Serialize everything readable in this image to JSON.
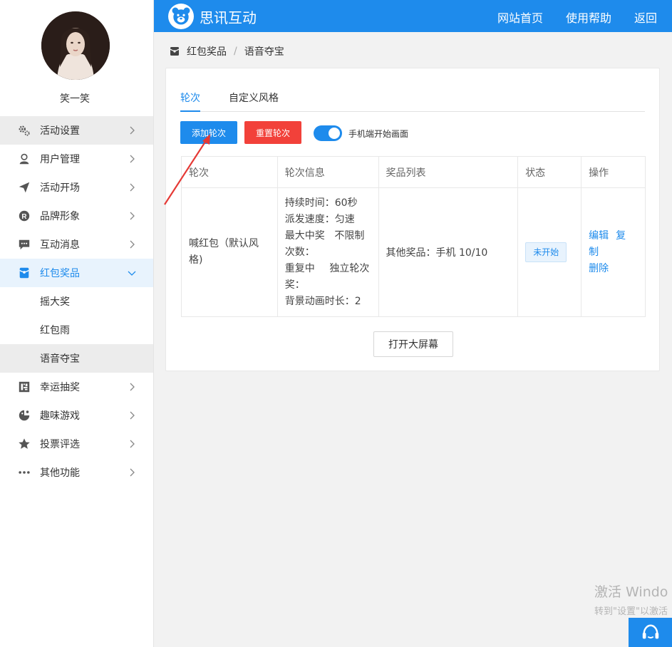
{
  "user": {
    "name": "笑一笑"
  },
  "sidebar": {
    "items": [
      {
        "label": "活动设置",
        "icon": "gears-icon"
      },
      {
        "label": "用户管理",
        "icon": "user-icon"
      },
      {
        "label": "活动开场",
        "icon": "paper-plane-icon"
      },
      {
        "label": "品牌形象",
        "icon": "registered-icon"
      },
      {
        "label": "互动消息",
        "icon": "chat-icon"
      },
      {
        "label": "红包奖品",
        "icon": "red-packet-icon"
      },
      {
        "label": "幸运抽奖",
        "icon": "lottery-icon"
      },
      {
        "label": "趣味游戏",
        "icon": "game-icon"
      },
      {
        "label": "投票评选",
        "icon": "star-icon"
      },
      {
        "label": "其他功能",
        "icon": "more-icon"
      }
    ],
    "sub_items": [
      "摇大奖",
      "红包雨",
      "语音夺宝"
    ]
  },
  "header": {
    "brand": "思讯互动",
    "nav": [
      "网站首页",
      "使用帮助",
      "返回"
    ]
  },
  "breadcrumb": {
    "parent": "红包奖品",
    "separator": "/",
    "current": "语音夺宝"
  },
  "tabs": [
    "轮次",
    "自定义风格"
  ],
  "toolbar": {
    "add_label": "添加轮次",
    "reset_label": "重置轮次",
    "switch_label": "手机端开始画面",
    "switch_on": true
  },
  "table": {
    "headers": [
      "轮次",
      "轮次信息",
      "奖品列表",
      "状态",
      "操作"
    ],
    "row": {
      "round": "喊红包（默认风格)",
      "info": {
        "duration": "持续时间：60秒",
        "speed": "派发速度：匀速",
        "max_left": "最大中奖次数：",
        "max_right": "不限制",
        "repeat_left": "重复中奖：",
        "repeat_right": "独立轮次",
        "bg_anim": "背景动画时长：2"
      },
      "prizes": "其他奖品：手机 10/10",
      "status": "未开始",
      "ops": [
        "编辑",
        "复制",
        "删除"
      ]
    }
  },
  "big_screen_label": "打开大屏幕",
  "watermark": {
    "line1": "激活 Windo",
    "line2": "转到\"设置\"以激活"
  },
  "colors": {
    "primary": "#1e8bec",
    "danger": "#f2413a",
    "annotation": "#e53935"
  }
}
